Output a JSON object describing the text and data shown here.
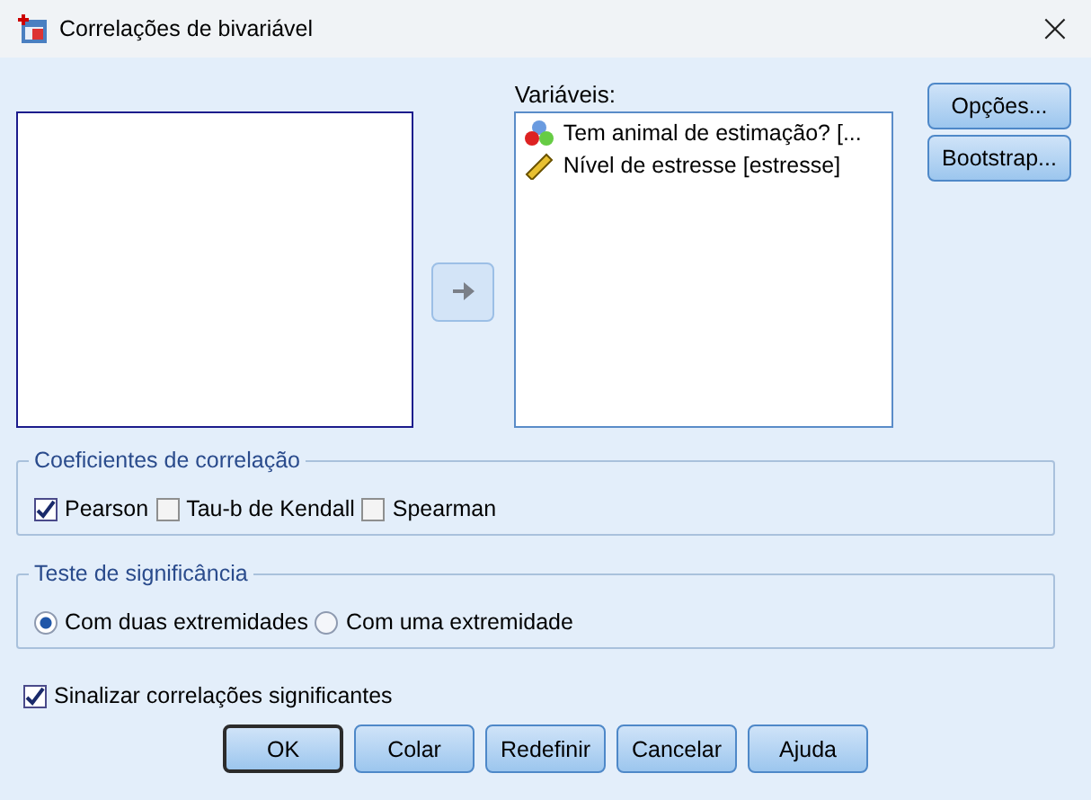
{
  "window": {
    "title": "Correlações de bivariável",
    "close": "×"
  },
  "move_button": {
    "disabled": true
  },
  "variables": {
    "label": "Variáveis:",
    "items": [
      {
        "label": "Tem animal de estimação? [...",
        "kind": "nominal"
      },
      {
        "label": "Nível de estresse [estresse]",
        "kind": "scale"
      }
    ]
  },
  "side_buttons": [
    "Opções...",
    "Bootstrap..."
  ],
  "coefficients": {
    "title": "Coeficientes de correlação",
    "options": [
      {
        "label": "Pearson",
        "checked": true
      },
      {
        "label": "Tau-b de Kendall",
        "checked": false
      },
      {
        "label": "Spearman",
        "checked": false
      }
    ]
  },
  "significance": {
    "title": "Teste de significância",
    "options": [
      {
        "label": "Com duas extremidades",
        "selected": true
      },
      {
        "label": "Com uma extremidade",
        "selected": false
      }
    ]
  },
  "flag": {
    "label": "Sinalizar correlações significantes",
    "checked": true
  },
  "buttons": [
    {
      "label": "OK",
      "default": true
    },
    {
      "label": "Colar",
      "default": false
    },
    {
      "label": "Redefinir",
      "default": false
    },
    {
      "label": "Cancelar",
      "default": false
    },
    {
      "label": "Ajuda",
      "default": false
    }
  ]
}
